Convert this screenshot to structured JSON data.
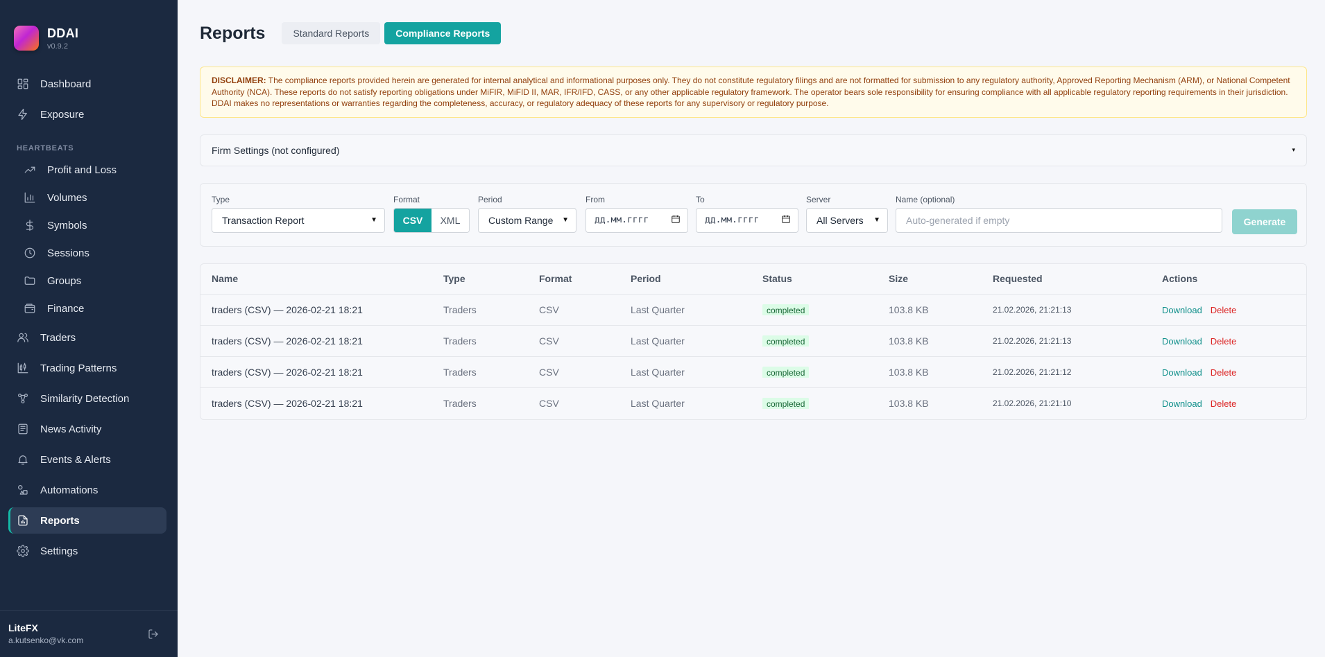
{
  "brand": {
    "name": "DDAI",
    "version": "v0.9.2"
  },
  "nav": {
    "dashboard": "Dashboard",
    "exposure": "Exposure",
    "section_heartbeats": "HEARTBEATS",
    "profit_loss": "Profit and Loss",
    "volumes": "Volumes",
    "symbols": "Symbols",
    "sessions": "Sessions",
    "groups": "Groups",
    "finance": "Finance",
    "traders": "Traders",
    "trading_patterns": "Trading Patterns",
    "similarity": "Similarity Detection",
    "news": "News Activity",
    "events": "Events & Alerts",
    "automations": "Automations",
    "reports": "Reports",
    "settings": "Settings"
  },
  "user": {
    "name": "LiteFX",
    "email": "a.kutsenko@vk.com"
  },
  "header": {
    "title": "Reports",
    "tab_standard": "Standard Reports",
    "tab_compliance": "Compliance Reports"
  },
  "disclaimer": {
    "label": "DISCLAIMER:",
    "text": " The compliance reports provided herein are generated for internal analytical and informational purposes only. They do not constitute regulatory filings and are not formatted for submission to any regulatory authority, Approved Reporting Mechanism (ARM), or National Competent Authority (NCA). These reports do not satisfy reporting obligations under MiFIR, MiFID II, MAR, IFR/IFD, CASS, or any other applicable regulatory framework. The operator bears sole responsibility for ensuring compliance with all applicable regulatory reporting requirements in their jurisdiction. DDAI makes no representations or warranties regarding the completeness, accuracy, or regulatory adequacy of these reports for any supervisory or regulatory purpose."
  },
  "firm_settings": {
    "label": "Firm Settings (not configured)",
    "caret": "▾"
  },
  "form": {
    "type_label": "Type",
    "type_value": "Transaction Report",
    "format_label": "Format",
    "format_csv": "CSV",
    "format_xml": "XML",
    "period_label": "Period",
    "period_value": "Custom Range",
    "from_label": "From",
    "from_value": "дд.мм.гггг",
    "to_label": "To",
    "to_value": "дд.мм.гггг",
    "server_label": "Server",
    "server_value": "All Servers",
    "name_label": "Name (optional)",
    "name_placeholder": "Auto-generated if empty",
    "generate": "Generate"
  },
  "table": {
    "headers": {
      "name": "Name",
      "type": "Type",
      "format": "Format",
      "period": "Period",
      "status": "Status",
      "size": "Size",
      "requested": "Requested",
      "actions": "Actions"
    },
    "rows": [
      {
        "name": "traders (CSV) — 2026-02-21 18:21",
        "type": "Traders",
        "format": "CSV",
        "period": "Last Quarter",
        "status": "completed",
        "size": "103.8 KB",
        "requested": "21.02.2026, 21:21:13"
      },
      {
        "name": "traders (CSV) — 2026-02-21 18:21",
        "type": "Traders",
        "format": "CSV",
        "period": "Last Quarter",
        "status": "completed",
        "size": "103.8 KB",
        "requested": "21.02.2026, 21:21:13"
      },
      {
        "name": "traders (CSV) — 2026-02-21 18:21",
        "type": "Traders",
        "format": "CSV",
        "period": "Last Quarter",
        "status": "completed",
        "size": "103.8 KB",
        "requested": "21.02.2026, 21:21:12"
      },
      {
        "name": "traders (CSV) — 2026-02-21 18:21",
        "type": "Traders",
        "format": "CSV",
        "period": "Last Quarter",
        "status": "completed",
        "size": "103.8 KB",
        "requested": "21.02.2026, 21:21:10"
      }
    ],
    "download_label": "Download",
    "delete_label": "Delete"
  }
}
